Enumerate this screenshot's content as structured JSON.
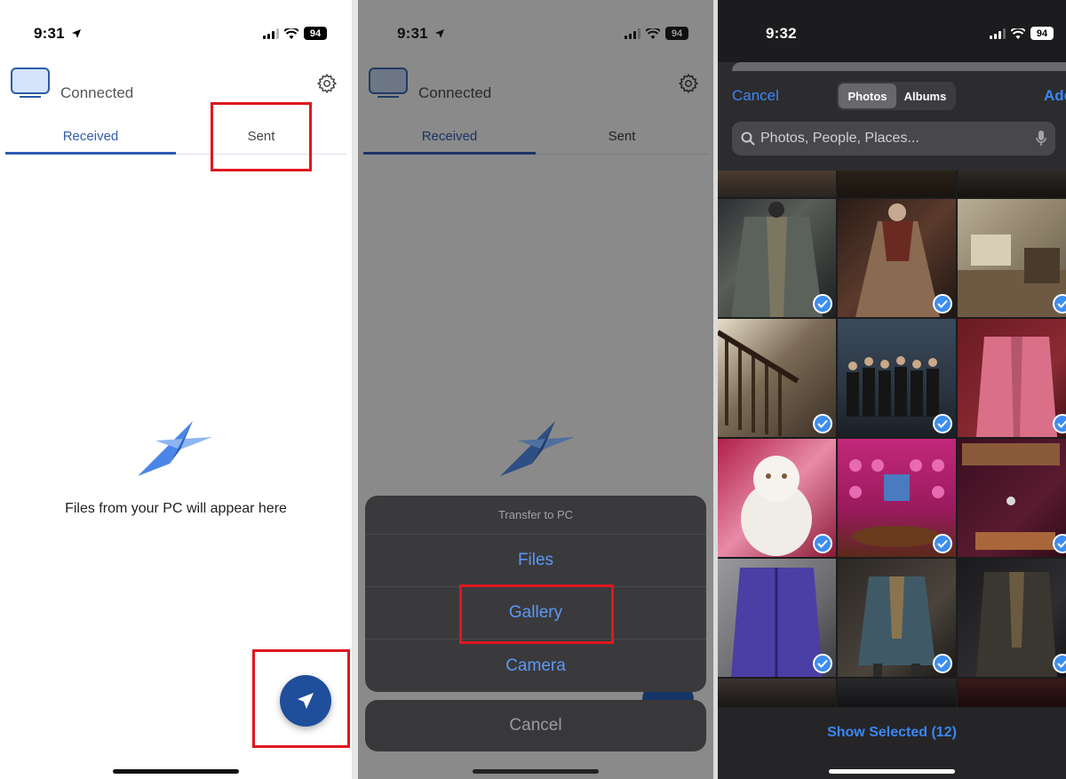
{
  "screens": [
    {
      "status": {
        "time": "9:31",
        "battery": "94"
      },
      "header": {
        "connection_status": "Connected"
      },
      "tabs": [
        {
          "label": "Received"
        },
        {
          "label": "Sent"
        }
      ],
      "empty_state": {
        "message": "Files from your PC will appear here"
      }
    },
    {
      "status": {
        "time": "9:31",
        "battery": "94"
      },
      "header": {
        "connection_status": "Connected"
      },
      "tabs": [
        {
          "label": "Received"
        },
        {
          "label": "Sent"
        }
      ],
      "action_sheet": {
        "title": "Transfer to PC",
        "options": [
          {
            "label": "Files"
          },
          {
            "label": "Gallery"
          },
          {
            "label": "Camera"
          }
        ],
        "cancel_label": "Cancel"
      }
    },
    {
      "status": {
        "time": "9:32",
        "battery": "94"
      },
      "picker": {
        "cancel_label": "Cancel",
        "add_label": "Add",
        "segments": [
          {
            "label": "Photos",
            "selected": true
          },
          {
            "label": "Albums",
            "selected": false
          }
        ],
        "search_placeholder": "Photos, People, Places...",
        "show_selected_label": "Show Selected (12)",
        "photos": [
          {
            "subject": "grey coat on mannequin",
            "selected": true
          },
          {
            "subject": "ornate dress costume",
            "selected": true
          },
          {
            "subject": "room interior",
            "selected": true
          },
          {
            "subject": "staircase",
            "selected": true
          },
          {
            "subject": "group photo in hall",
            "selected": true
          },
          {
            "subject": "pink jacket costume",
            "selected": true
          },
          {
            "subject": "white fluffy cat",
            "selected": true
          },
          {
            "subject": "pink room with plates",
            "selected": true
          },
          {
            "subject": "dark red display",
            "selected": true
          },
          {
            "subject": "purple jacket",
            "selected": true
          },
          {
            "subject": "teal coat",
            "selected": true
          },
          {
            "subject": "dark coat",
            "selected": true
          }
        ]
      }
    }
  ],
  "colors": {
    "accent_blue": "#1f4e9b",
    "tab_active": "#2f5db3",
    "ios_link": "#3a87f5",
    "highlight_red": "#e0171f"
  }
}
